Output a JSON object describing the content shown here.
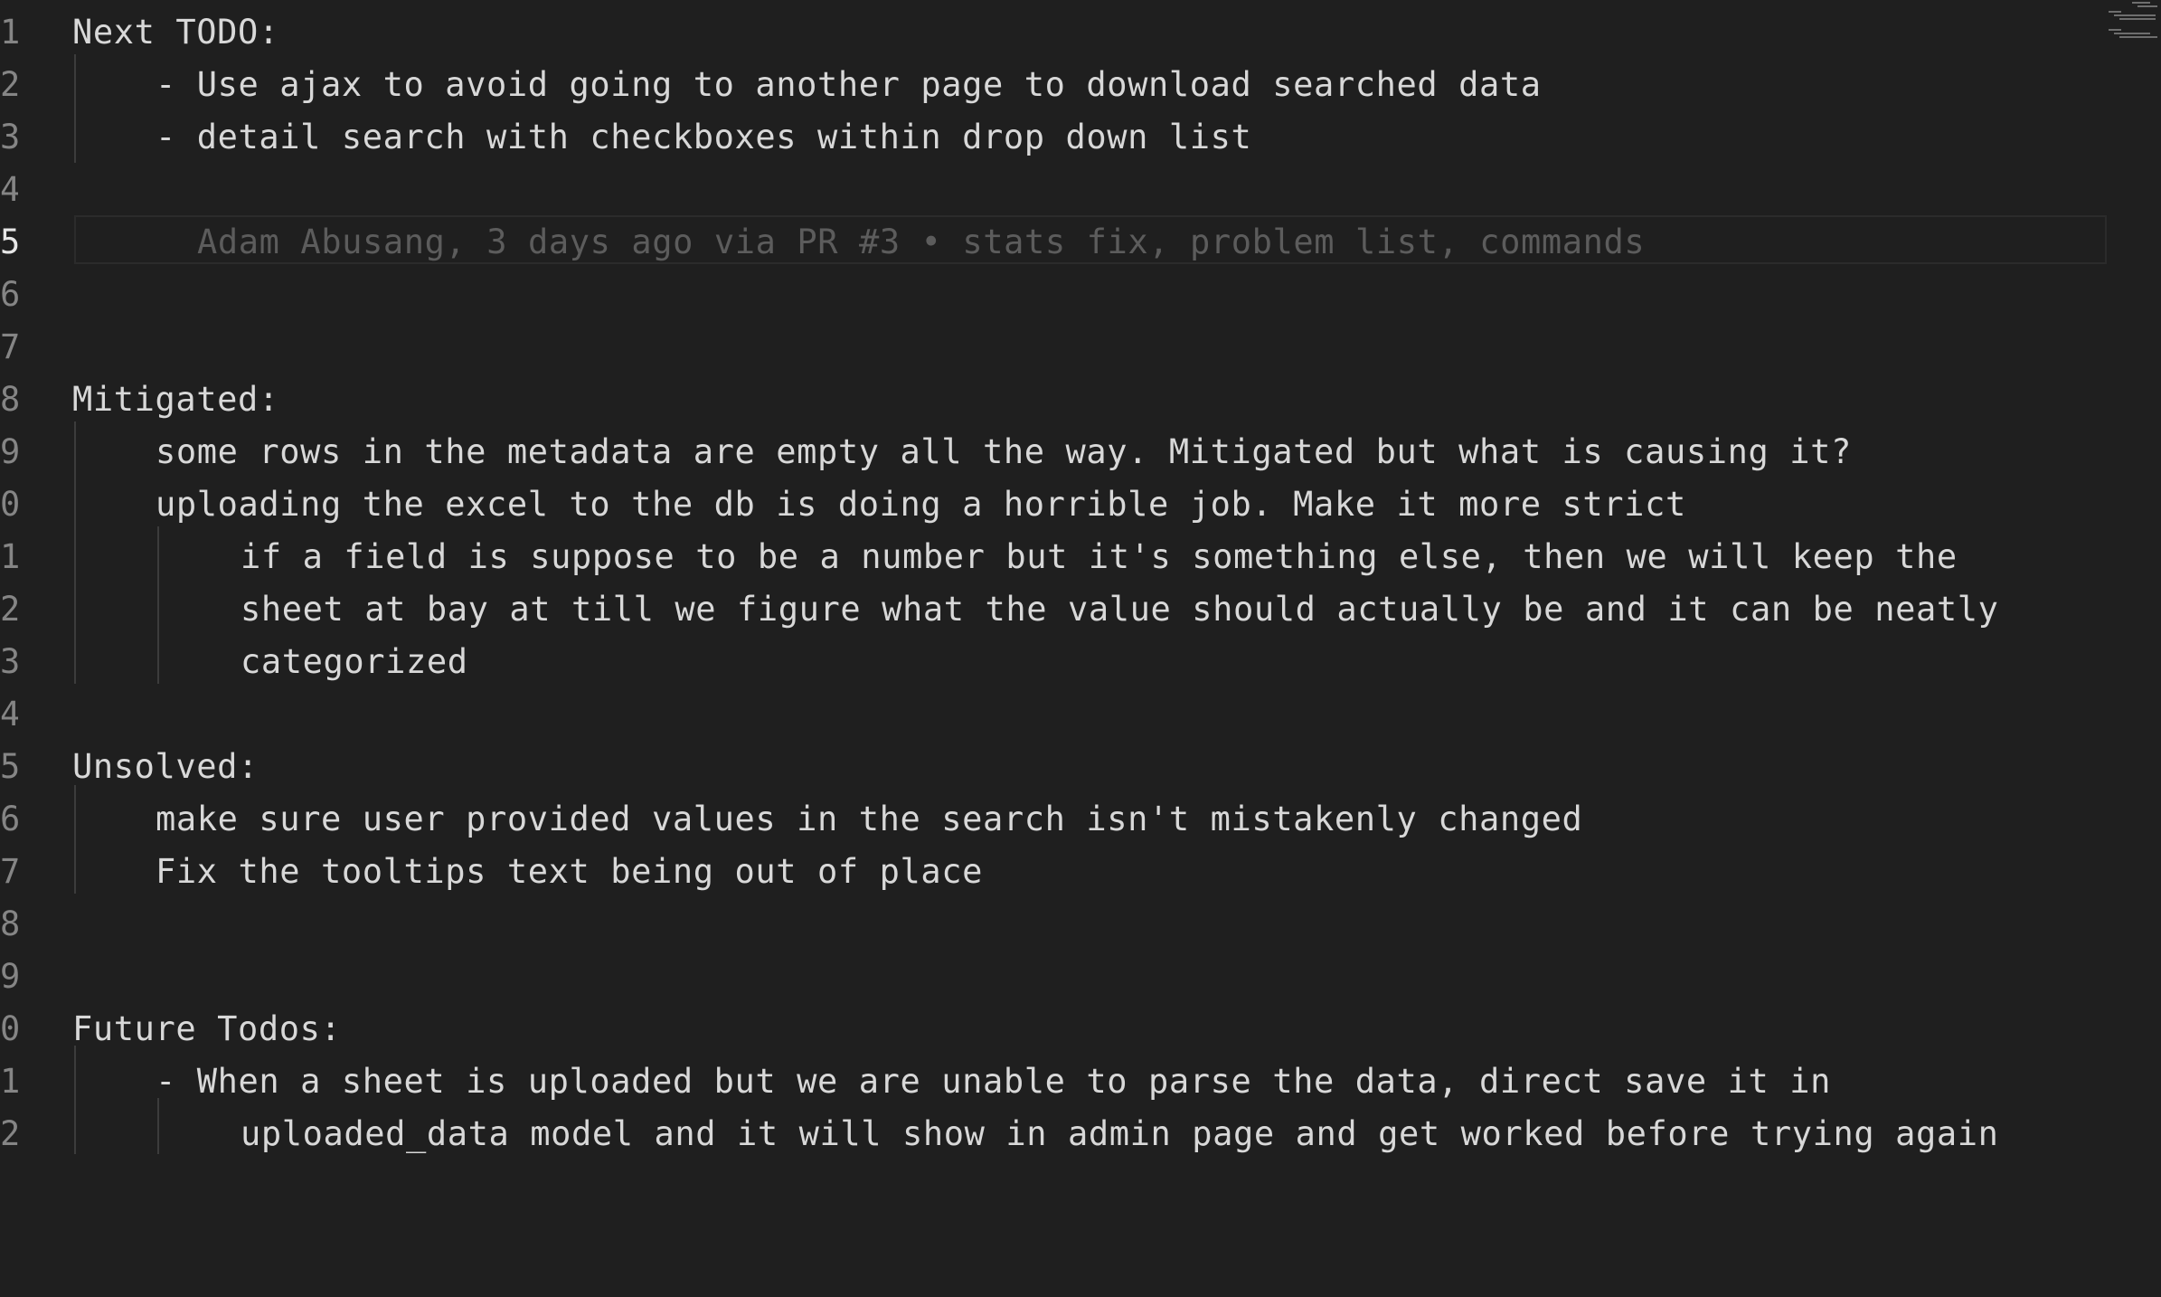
{
  "editor": {
    "active_line_number": "5",
    "lines": [
      {
        "number": "1",
        "text": "Next TODO:"
      },
      {
        "number": "2",
        "text": "- Use ajax to avoid going to another page to download searched data"
      },
      {
        "number": "3",
        "text": "- detail search with checkboxes within drop down list"
      },
      {
        "number": "4",
        "text": ""
      },
      {
        "number": "5",
        "text": ""
      },
      {
        "number": "6",
        "text": ""
      },
      {
        "number": "7",
        "text": ""
      },
      {
        "number": "8",
        "text": "Mitigated:"
      },
      {
        "number": "9",
        "text": "some rows in the metadata are empty all the way. Mitigated but what is causing it?"
      },
      {
        "number": "0",
        "text": "uploading the excel to the db is doing a horrible job. Make it more strict"
      },
      {
        "number": "1",
        "text": "if a field is suppose to be a number but it's something else, then we will keep the"
      },
      {
        "number": "2",
        "text": "sheet at bay at till we figure what the value should actually be and it can be neatly"
      },
      {
        "number": "3",
        "text": "categorized"
      },
      {
        "number": "4",
        "text": ""
      },
      {
        "number": "5",
        "text": "Unsolved:"
      },
      {
        "number": "6",
        "text": "make sure user provided values in the search isn't mistakenly changed"
      },
      {
        "number": "7",
        "text": "Fix the tooltips text being out of place"
      },
      {
        "number": "8",
        "text": ""
      },
      {
        "number": "9",
        "text": ""
      },
      {
        "number": "0",
        "text": "Future Todos:"
      },
      {
        "number": "1",
        "text": "- When a sheet is uploaded but we are unable to parse the data, direct save it in"
      },
      {
        "number": "2",
        "text": "uploaded_data model and it will show in admin page and get worked before trying again"
      }
    ],
    "blame_annotation": "Adam Abusang, 3 days ago via PR #3 • stats fix, problem list, commands"
  }
}
